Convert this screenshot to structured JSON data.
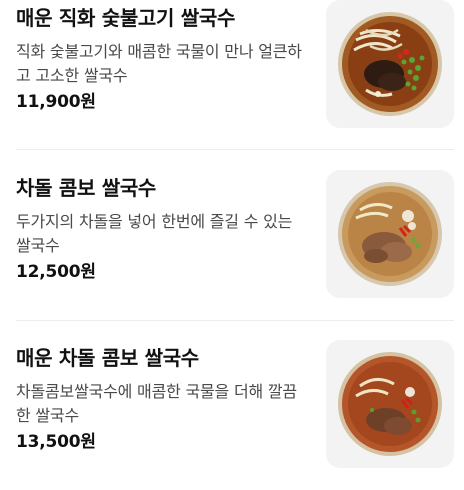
{
  "menu": {
    "items": [
      {
        "name": "매운 직화 숯불고기 쌀국수",
        "description": "직화 숯불고기와 매콤한 국물이 만나 얼큰하고 고소한 쌀국수",
        "price": "11,900원",
        "image_icon": "spicy-charcoal-pork-pho-icon"
      },
      {
        "name": "차돌 콤보 쌀국수",
        "description": "두가지의 차돌을 넣어 한번에 즐길 수 있는 쌀국수",
        "price": "12,500원",
        "image_icon": "brisket-combo-pho-icon"
      },
      {
        "name": "매운 차돌 콤보 쌀국수",
        "description": "차돌콤보쌀국수에 매콤한 국물을 더해 깔끔한 쌀국수",
        "price": "13,500원",
        "image_icon": "spicy-brisket-combo-pho-icon"
      }
    ]
  },
  "colors": {
    "title": "#111111",
    "description": "#4a4a4a",
    "price": "#111111",
    "thumb_bg": "#f3f3f3",
    "divider": "#ececec"
  }
}
